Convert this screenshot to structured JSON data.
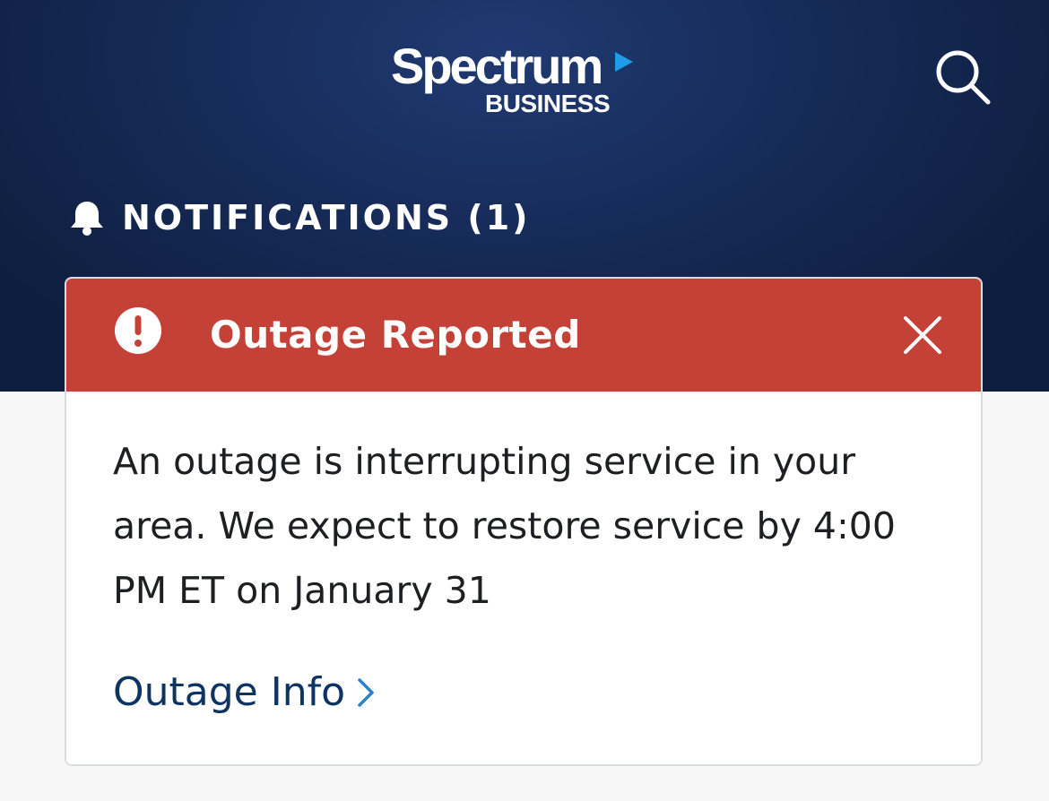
{
  "header": {
    "brand_name": "Spectrum",
    "brand_sub": "BUSINESS",
    "search_icon": "search-icon"
  },
  "notifications": {
    "label": "NOTIFICATIONS (1)",
    "icon": "bell-icon"
  },
  "alert_card": {
    "title": "Outage Reported",
    "icon": "exclamation-circle-icon",
    "close_icon": "close-icon",
    "message": "An outage is interrupting service in your area. We expect to restore service by 4:00 PM ET on January 31",
    "link_label": "Outage Info",
    "link_icon": "chevron-right-icon"
  },
  "colors": {
    "header_bg": "#172c5a",
    "alert_red": "#c44137",
    "link_navy": "#0e3461",
    "brand_arrow": "#1f9ce8",
    "page_bg": "#f7f7f8"
  }
}
